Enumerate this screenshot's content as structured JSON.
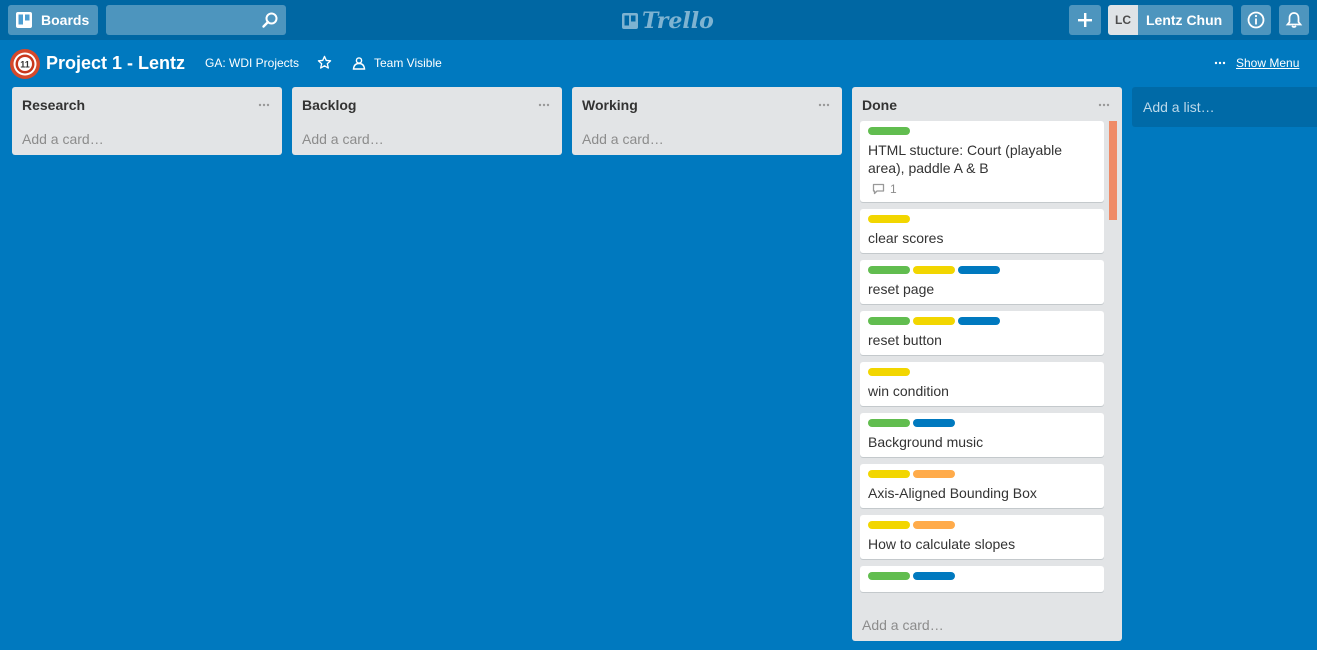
{
  "header": {
    "boards_label": "Boards",
    "search_placeholder": "",
    "logo_text": "Trello",
    "member_initials": "LC",
    "member_name": "Lentz Chun"
  },
  "board": {
    "title": "Project 1 - Lentz",
    "org": "GA: WDI Projects",
    "visibility": "Team Visible",
    "show_menu": "Show Menu",
    "add_list": "Add a list…"
  },
  "colors": {
    "green": "#61bd4f",
    "yellow": "#f2d600",
    "blue": "#0079bf",
    "orange": "#ffab4a"
  },
  "lists": [
    {
      "title": "Research",
      "add_card": "Add a card…"
    },
    {
      "title": "Backlog",
      "add_card": "Add a card…"
    },
    {
      "title": "Working",
      "add_card": "Add a card…"
    },
    {
      "title": "Done",
      "add_card": "Add a card…",
      "cards": [
        {
          "labels": [
            "green"
          ],
          "title": "HTML stucture: Court (playable area), paddle A & B",
          "comments": "1"
        },
        {
          "labels": [
            "yellow"
          ],
          "title": "clear scores"
        },
        {
          "labels": [
            "green",
            "yellow",
            "blue"
          ],
          "title": "reset page"
        },
        {
          "labels": [
            "green",
            "yellow",
            "blue"
          ],
          "title": "reset button"
        },
        {
          "labels": [
            "yellow"
          ],
          "title": "win condition"
        },
        {
          "labels": [
            "green",
            "blue"
          ],
          "title": "Background music"
        },
        {
          "labels": [
            "yellow",
            "orange"
          ],
          "title": "Axis-Aligned Bounding Box"
        },
        {
          "labels": [
            "yellow",
            "orange"
          ],
          "title": "How to calculate slopes"
        },
        {
          "labels": [
            "green",
            "blue"
          ],
          "title": ""
        }
      ]
    }
  ]
}
